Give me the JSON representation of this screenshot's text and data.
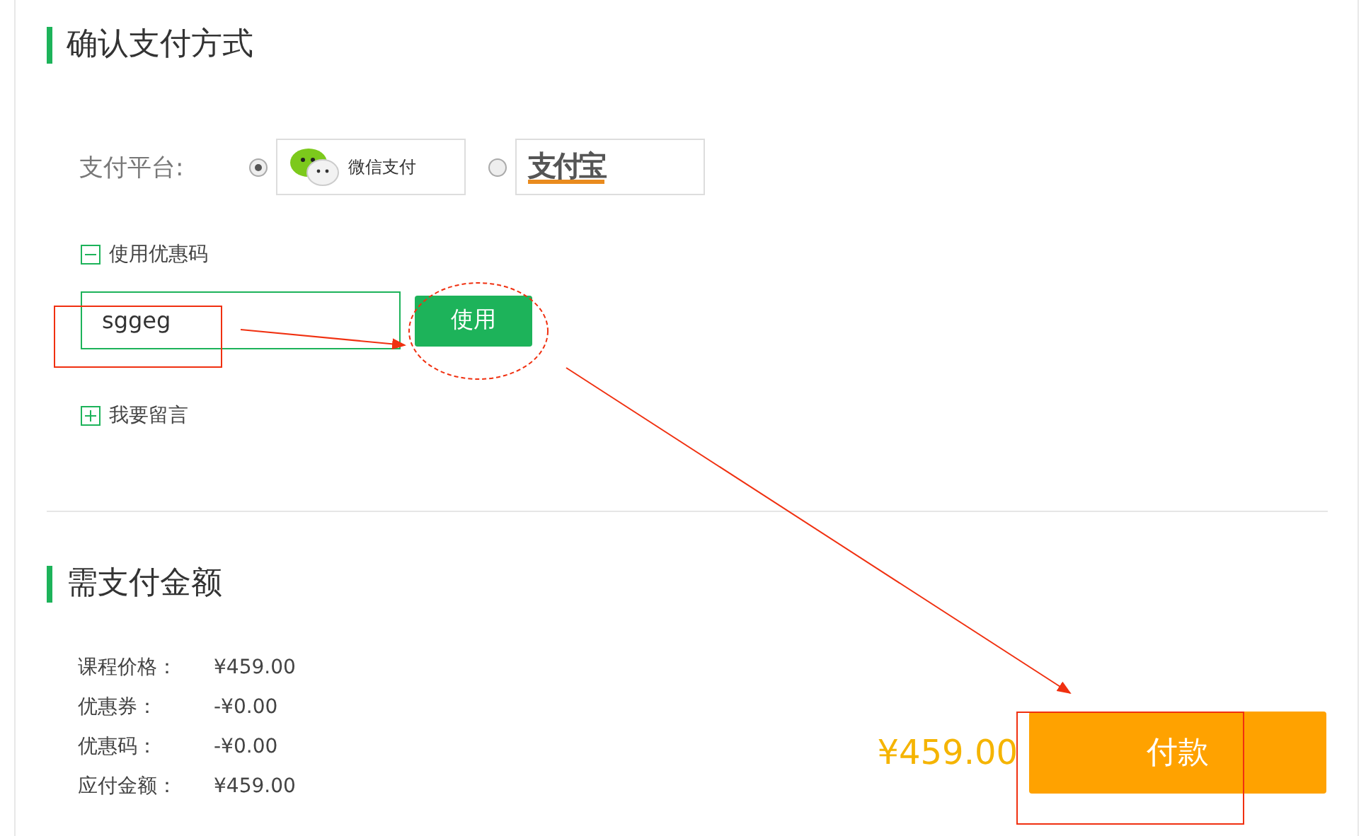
{
  "payment_section": {
    "title": "确认支付方式",
    "platform_label": "支付平台:",
    "options": [
      {
        "kind": "wechat",
        "label": "微信支付",
        "selected": true
      },
      {
        "kind": "alipay",
        "label": "支付宝",
        "selected": false
      }
    ]
  },
  "coupon": {
    "label": "使用优惠码",
    "expanded": true,
    "value": "sggeg",
    "button": "使用"
  },
  "message": {
    "label": "我要留言",
    "expanded": false
  },
  "amount_section": {
    "title": "需支付金额",
    "rows": [
      {
        "label": "课程价格：",
        "value": "¥459.00"
      },
      {
        "label": "优惠券：",
        "value": "-¥0.00"
      },
      {
        "label": "优惠码：",
        "value": "-¥0.00"
      },
      {
        "label": "应付金额：",
        "value": "¥459.00"
      }
    ],
    "total": "¥459.00",
    "pay_button": "付款"
  }
}
